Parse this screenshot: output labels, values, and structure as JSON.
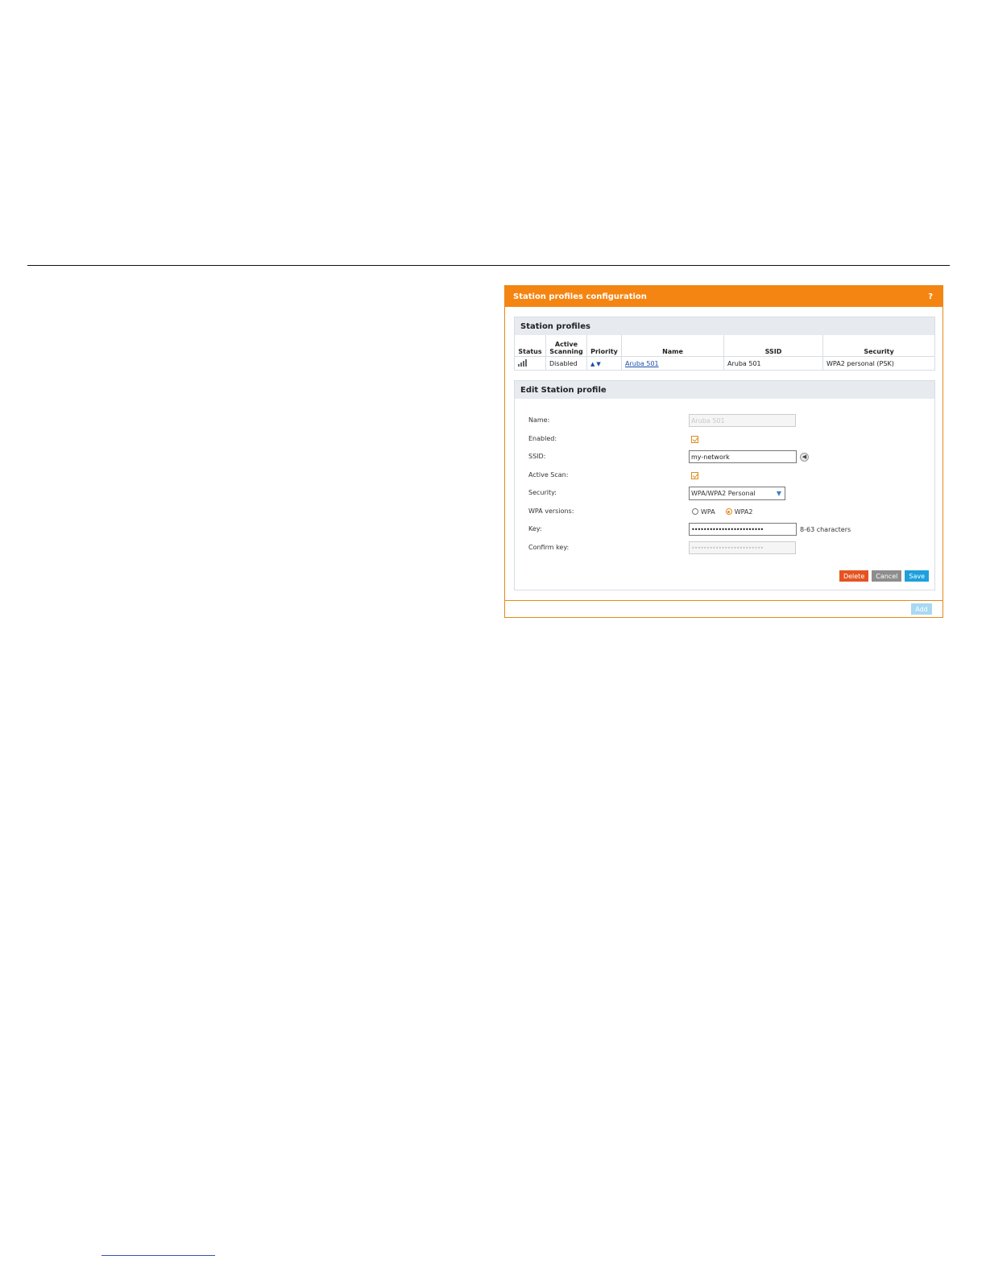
{
  "panel": {
    "title": "Station profiles configuration",
    "help_icon": "?"
  },
  "profiles": {
    "section_title": "Station profiles",
    "columns": {
      "status": "Status",
      "active_scanning_1": "Active",
      "active_scanning_2": "Scanning",
      "priority": "Priority",
      "name": "Name",
      "ssid": "SSID",
      "security": "Security"
    },
    "rows": [
      {
        "status_icon": "signal-strength-icon",
        "active_scanning": "Disabled",
        "priority_up": "▲",
        "priority_down": "▼",
        "name": "Aruba 501",
        "ssid": "Aruba 501",
        "security": "WPA2 personal (PSK)"
      }
    ]
  },
  "edit": {
    "section_title": "Edit Station profile",
    "name_label": "Name:",
    "name_value": "Aruba 501",
    "enabled_label": "Enabled:",
    "enabled_checked": true,
    "ssid_label": "SSID:",
    "ssid_value": "my-network",
    "active_scan_label": "Active Scan:",
    "active_scan_checked": true,
    "security_label": "Security:",
    "security_value": "WPA/WPA2 Personal",
    "wpa_versions_label": "WPA versions:",
    "wpa_option_1": "WPA",
    "wpa_option_2": "WPA2",
    "wpa_selected": "WPA2",
    "key_label": "Key:",
    "key_value": "••••••••••••••••••••••••",
    "key_hint": "8-63 characters",
    "confirm_key_label": "Confirm key:",
    "confirm_key_value": "••••••••••••••••••••••••",
    "delete_label": "Delete",
    "cancel_label": "Cancel",
    "save_label": "Save"
  },
  "footer": {
    "add_label": "Add"
  },
  "colors": {
    "header_orange": "#f58512",
    "delete_red": "#e55420",
    "cancel_gray": "#8d8d8d",
    "save_blue": "#1ea0dc",
    "add_disabled_blue": "#a8d9f2"
  }
}
